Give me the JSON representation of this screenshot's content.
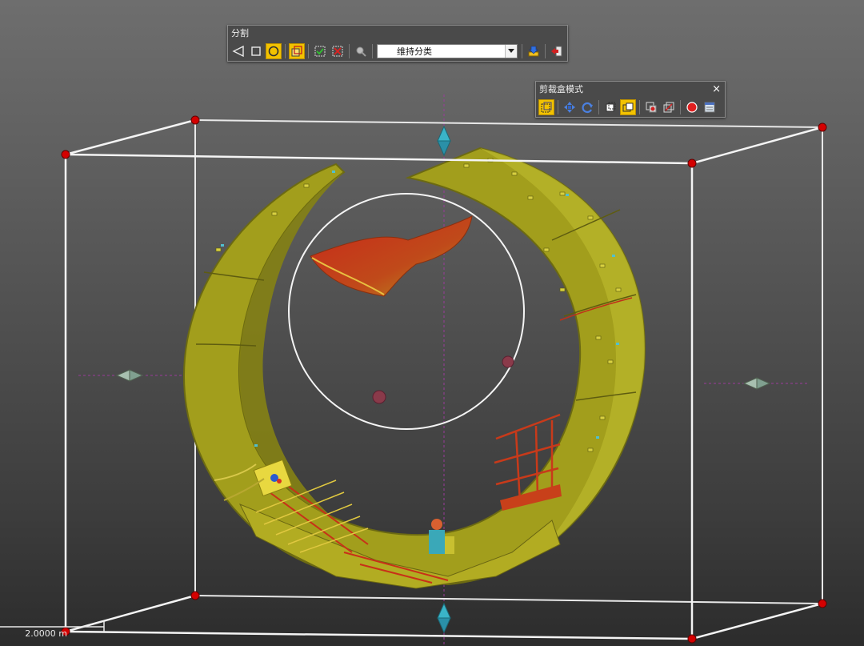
{
  "viewport": {
    "background_top": "#6e6e6e",
    "background_bottom": "#2c2c2c",
    "scale_label": "2.0000 m"
  },
  "segment_toolbar": {
    "title": "分割",
    "buttons": [
      {
        "name": "polygon-select-icon",
        "active": false
      },
      {
        "name": "rectangle-select-icon",
        "active": false
      },
      {
        "name": "circle-select-icon",
        "active": true
      },
      {
        "name": "segment-mode-icon",
        "active": true
      },
      {
        "name": "keep-inside-icon",
        "active": false
      },
      {
        "name": "remove-inside-icon",
        "active": false
      },
      {
        "name": "pick-class-icon",
        "active": false
      }
    ],
    "class_select": {
      "value": "维持分类"
    },
    "confirm_icon": "download-confirm-icon",
    "exit_icon": "exit-icon"
  },
  "clipbox_toolbar": {
    "title": "剪裁盒模式",
    "close_label": "×",
    "buttons": [
      {
        "name": "clipbox-fit-icon",
        "active": true
      },
      {
        "name": "move-icon",
        "active": false
      },
      {
        "name": "rotate-icon",
        "active": false
      },
      {
        "name": "clip-inside-icon",
        "active": false
      },
      {
        "name": "clip-outside-icon",
        "active": true
      },
      {
        "name": "add-box-icon",
        "active": false
      },
      {
        "name": "box-view-icon",
        "active": false
      },
      {
        "name": "record-icon",
        "active": false
      },
      {
        "name": "settings-panel-icon",
        "active": false
      }
    ]
  },
  "colors": {
    "box_edge": "#f0f0f0",
    "box_corner": "#d40000",
    "tunnel_main": "#a8a020",
    "tunnel_dark": "#6e6a10",
    "highlight_red": "#d83a1a",
    "handle_cyan": "#3ab4c8",
    "axis_magenta": "#9a3a9a"
  }
}
